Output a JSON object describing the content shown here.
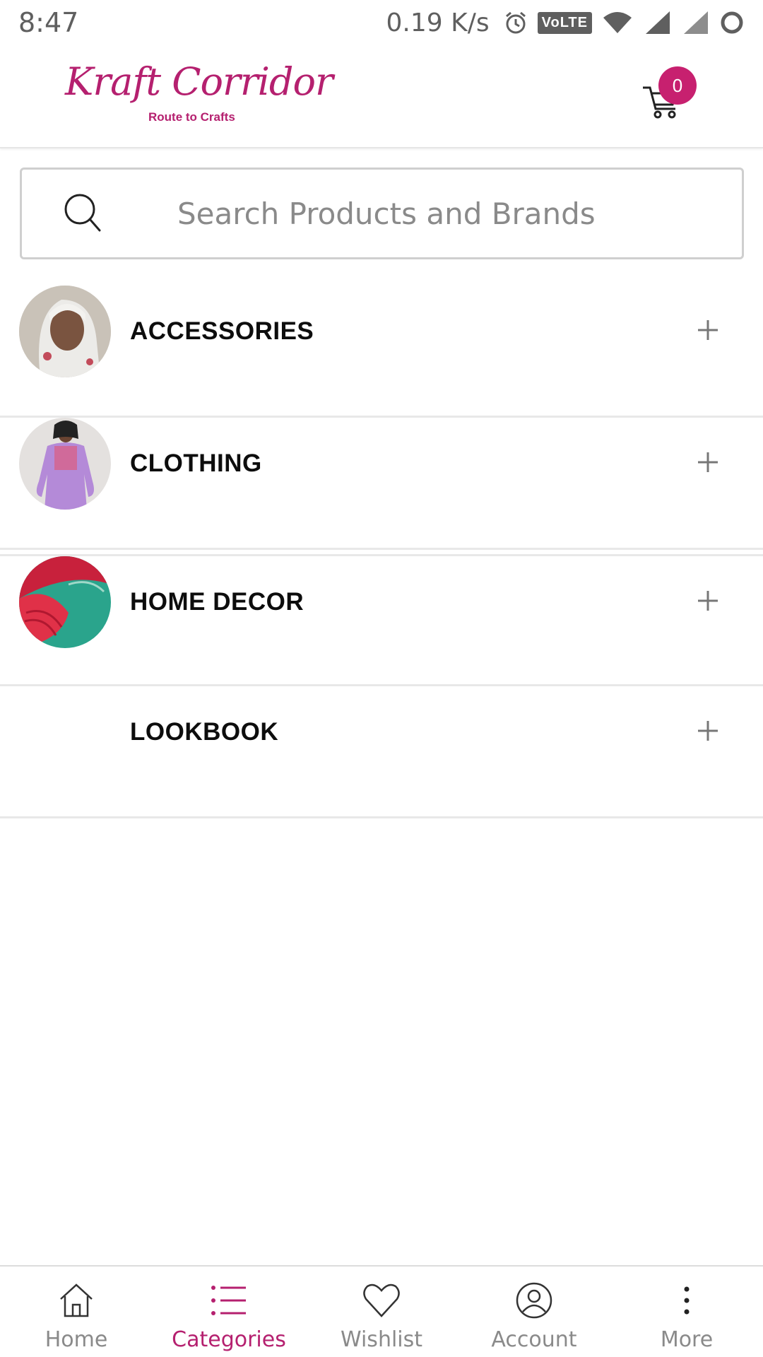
{
  "status_bar": {
    "time": "8:47",
    "network_speed": "0.19 K/s",
    "volte": "VoLTE",
    "icons": [
      "alarm-icon",
      "volte-icon",
      "wifi-icon",
      "signal-icon",
      "signal-icon",
      "battery-icon"
    ]
  },
  "header": {
    "logo_text": "Kraft Corridor",
    "logo_tagline": "Route to Crafts",
    "cart_count": "0"
  },
  "search": {
    "placeholder": "Search Products and Brands",
    "value": ""
  },
  "categories": [
    {
      "label": "ACCESSORIES",
      "icon": "plus-icon"
    },
    {
      "label": "CLOTHING",
      "icon": "plus-icon"
    },
    {
      "label": "HOME DECOR",
      "icon": "plus-icon"
    },
    {
      "label": "LOOKBOOK",
      "icon": "plus-icon"
    }
  ],
  "bottom_nav": {
    "items": [
      {
        "label": "Home",
        "icon": "home-icon"
      },
      {
        "label": "Categories",
        "icon": "list-icon",
        "active": true
      },
      {
        "label": "Wishlist",
        "icon": "heart-icon"
      },
      {
        "label": "Account",
        "icon": "user-icon"
      },
      {
        "label": "More",
        "icon": "more-vertical-icon"
      }
    ]
  },
  "colors": {
    "brand": "#b5206f",
    "badge": "#c7206f",
    "muted_text": "#8a8a8a",
    "divider": "#e8e8e8"
  }
}
